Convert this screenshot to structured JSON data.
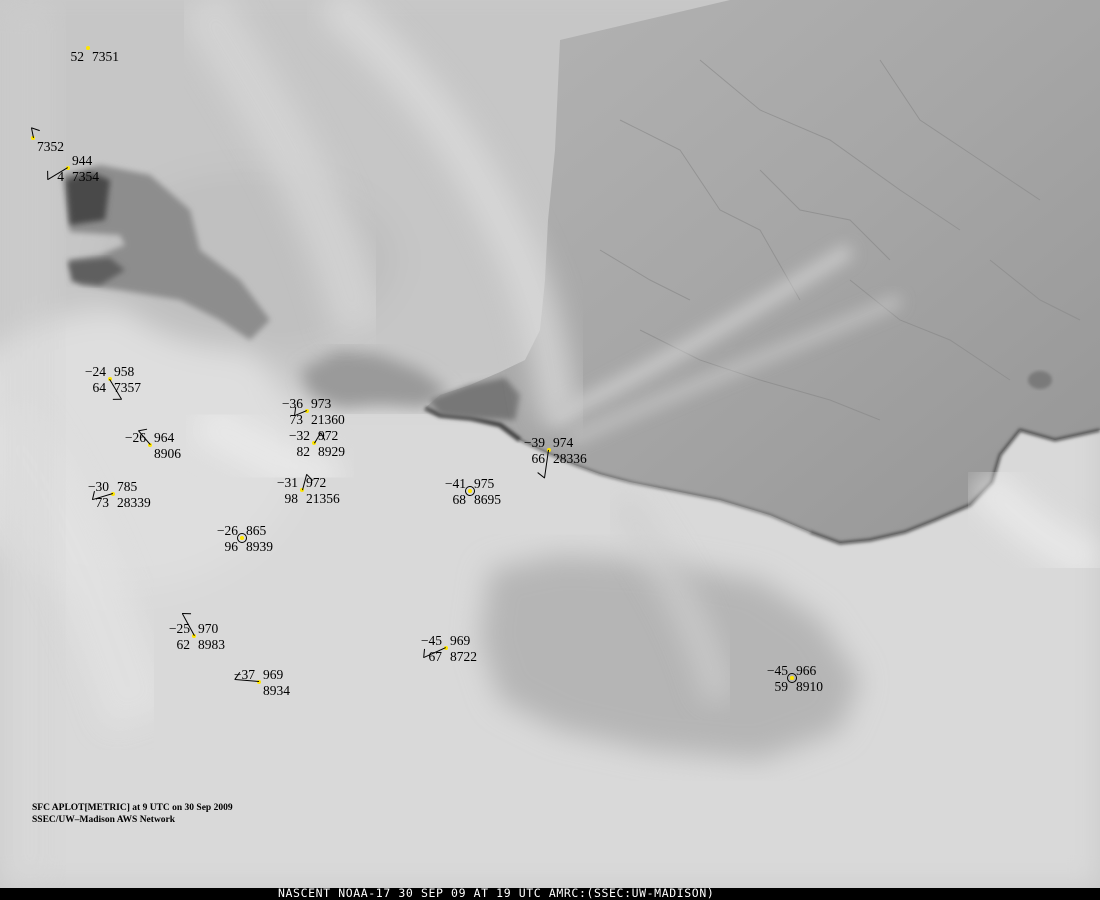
{
  "image": {
    "footer": "NASCENT NOAA-17 30 SEP 09 AT 19 UTC AMRC:(SSEC:UW-MADISON)",
    "caption_line1": "SFC APLOT[METRIC] at 9 UTC on 30 Sep 2009",
    "caption_line2": "SSEC/UW–Madison AWS Network"
  },
  "colors": {
    "station_dot": "#ffe600",
    "station_text": "#000000",
    "footer_bg": "#000000",
    "footer_text": "#ffffff"
  },
  "stations": [
    {
      "id": "7351",
      "temp": "",
      "pressure": "",
      "dewpoint": "52",
      "station_id": "7351",
      "wind_barb": false,
      "calm": false
    },
    {
      "id": "7352",
      "temp": "",
      "pressure": "",
      "dewpoint": "",
      "station_id": "7352",
      "wind_barb": true,
      "calm": false
    },
    {
      "id": "7354",
      "temp": "",
      "pressure": "944",
      "dewpoint": "4",
      "station_id": "7354",
      "wind_barb": true,
      "calm": false
    },
    {
      "id": "7357",
      "temp": "−24",
      "pressure": "958",
      "dewpoint": "64",
      "station_id": "7357",
      "wind_barb": true,
      "calm": false
    },
    {
      "id": "21360",
      "temp": "−36",
      "pressure": "973",
      "dewpoint": "73",
      "station_id": "21360",
      "wind_barb": true,
      "calm": false
    },
    {
      "id": "8929",
      "temp": "−32",
      "pressure": "972",
      "dewpoint": "82",
      "station_id": "8929",
      "wind_barb": true,
      "calm": false
    },
    {
      "id": "8906",
      "temp": "−26",
      "pressure": "964",
      "dewpoint": "",
      "station_id": "8906",
      "wind_barb": true,
      "calm": false
    },
    {
      "id": "28336",
      "temp": "−39",
      "pressure": "974",
      "dewpoint": "66",
      "station_id": "28336",
      "wind_barb": true,
      "calm": false
    },
    {
      "id": "8695",
      "temp": "−41",
      "pressure": "975",
      "dewpoint": "68",
      "station_id": "8695",
      "wind_barb": false,
      "calm": true
    },
    {
      "id": "28339",
      "temp": "−30",
      "pressure": "785",
      "dewpoint": "73",
      "station_id": "28339",
      "wind_barb": true,
      "calm": false
    },
    {
      "id": "21356",
      "temp": "−31",
      "pressure": "972",
      "dewpoint": "98",
      "station_id": "21356",
      "wind_barb": true,
      "calm": false
    },
    {
      "id": "8939",
      "temp": "−26",
      "pressure": "865",
      "dewpoint": "96",
      "station_id": "8939",
      "wind_barb": false,
      "calm": true
    },
    {
      "id": "8983",
      "temp": "−25",
      "pressure": "970",
      "dewpoint": "62",
      "station_id": "8983",
      "wind_barb": true,
      "calm": false
    },
    {
      "id": "8722",
      "temp": "−45",
      "pressure": "969",
      "dewpoint": "67",
      "station_id": "8722",
      "wind_barb": true,
      "calm": false
    },
    {
      "id": "8934",
      "temp": "−37",
      "pressure": "969",
      "dewpoint": "",
      "station_id": "8934",
      "wind_barb": true,
      "calm": false
    },
    {
      "id": "8910",
      "temp": "−45",
      "pressure": "966",
      "dewpoint": "59",
      "station_id": "8910",
      "wind_barb": false,
      "calm": true
    }
  ]
}
